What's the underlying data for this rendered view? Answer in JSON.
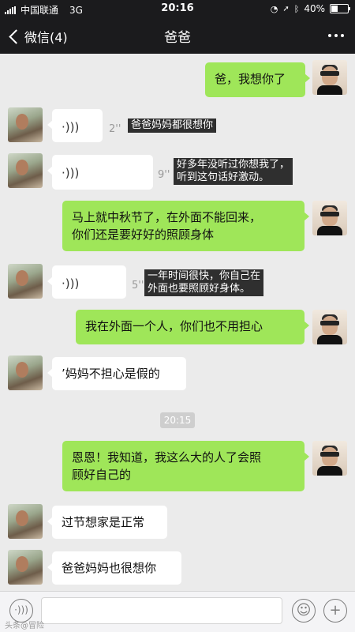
{
  "status_bar": {
    "carrier": "中国联通",
    "network": "3G",
    "time": "20:16",
    "battery": "40%",
    "battery_level": 0.4
  },
  "nav": {
    "back_label": "微信(4)",
    "title": "爸爸"
  },
  "messages": [
    {
      "side": "right",
      "type": "text",
      "text": "爸，我想你了"
    },
    {
      "side": "left",
      "type": "voice",
      "duration": "2''",
      "caption": "爸爸妈妈都很想你"
    },
    {
      "side": "left",
      "type": "voice",
      "duration": "9''",
      "caption_line1": "好多年没听过你想我了，",
      "caption_line2": "听到这句话好激动。"
    },
    {
      "side": "right",
      "type": "text",
      "line1": "马上就中秋节了，在外面不能回来，",
      "line2": "你们还是要好好的照顾身体"
    },
    {
      "side": "left",
      "type": "voice",
      "duration": "5''",
      "caption_line1": "一年时间很快，你自己在",
      "caption_line2": "外面也要照顾好身体。"
    },
    {
      "side": "right",
      "type": "text",
      "text": "我在外面一个人，你们也不用担心"
    },
    {
      "side": "left",
      "type": "text",
      "text": "’妈妈不担心是假的"
    },
    {
      "side": "center",
      "type": "time",
      "text": "20:15"
    },
    {
      "side": "right",
      "type": "text",
      "line1": "恩恩！我知道，我这么大的人了会照",
      "line2": "顾好自己的"
    },
    {
      "side": "left",
      "type": "text",
      "text": "过节想家是正常"
    },
    {
      "side": "left",
      "type": "text",
      "text": "爸爸妈妈也很想你"
    }
  ],
  "input_bar": {
    "voice_icon": "voice-wave-icon",
    "emoji_icon": "emoji-face-icon",
    "plus_icon": "plus-icon",
    "watermark": "头条@冒险"
  },
  "colors": {
    "sent_bubble": "#9fe659",
    "received_bubble": "#ffffff",
    "chat_background": "#ebebeb",
    "header": "#1b1b1d"
  }
}
